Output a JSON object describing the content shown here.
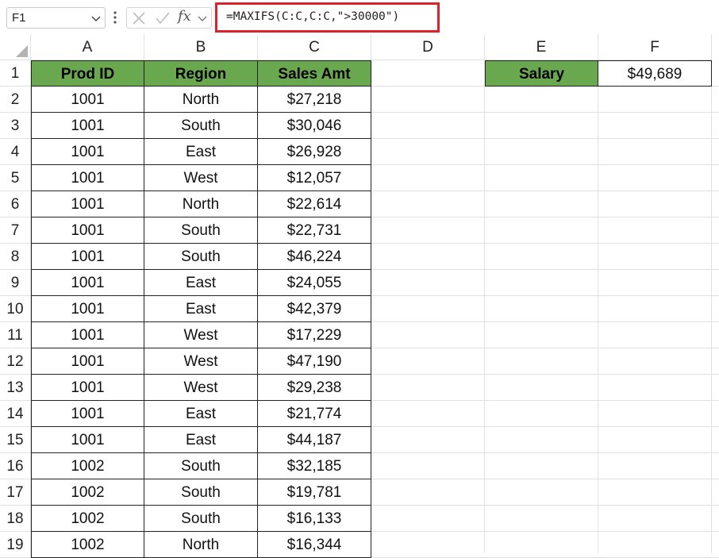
{
  "formula_bar": {
    "name_box": "F1",
    "formula": "=MAXIFS(C:C,C:C,\">30000\")"
  },
  "columns": [
    "A",
    "B",
    "C",
    "D",
    "E",
    "F"
  ],
  "rows": [
    "1",
    "2",
    "3",
    "4",
    "5",
    "6",
    "7",
    "8",
    "9",
    "10",
    "11",
    "12",
    "13",
    "14",
    "15",
    "16",
    "17",
    "18",
    "19"
  ],
  "table": {
    "headers": [
      "Prod ID",
      "Region",
      "Sales Amt"
    ],
    "data": [
      [
        "1001",
        "North",
        "$27,218"
      ],
      [
        "1001",
        "South",
        "$30,046"
      ],
      [
        "1001",
        "East",
        "$26,928"
      ],
      [
        "1001",
        "West",
        "$12,057"
      ],
      [
        "1001",
        "North",
        "$22,614"
      ],
      [
        "1001",
        "South",
        "$22,731"
      ],
      [
        "1001",
        "South",
        "$46,224"
      ],
      [
        "1001",
        "East",
        "$24,055"
      ],
      [
        "1001",
        "East",
        "$42,379"
      ],
      [
        "1001",
        "West",
        "$17,229"
      ],
      [
        "1001",
        "West",
        "$47,190"
      ],
      [
        "1001",
        "West",
        "$29,238"
      ],
      [
        "1001",
        "East",
        "$21,774"
      ],
      [
        "1001",
        "East",
        "$44,187"
      ],
      [
        "1002",
        "South",
        "$32,185"
      ],
      [
        "1002",
        "South",
        "$19,781"
      ],
      [
        "1002",
        "South",
        "$16,133"
      ],
      [
        "1002",
        "North",
        "$16,344"
      ]
    ]
  },
  "result": {
    "label": "Salary",
    "value": "$49,689"
  },
  "colors": {
    "header_fill": "#6aa84f",
    "highlight_border": "#e0202a"
  }
}
